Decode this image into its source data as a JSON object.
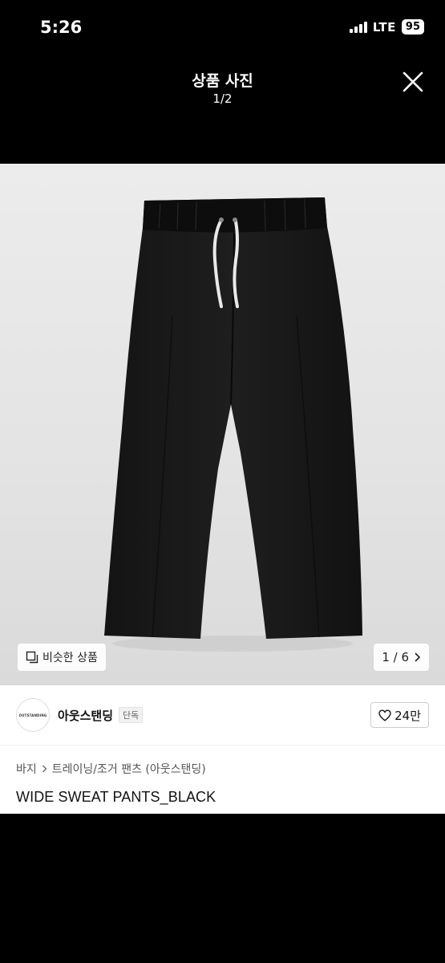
{
  "status_bar": {
    "time": "5:26",
    "network": "LTE",
    "battery": "95"
  },
  "viewer": {
    "title": "상품 사진",
    "counter": "1/2",
    "close_icon": "close-icon"
  },
  "photo": {
    "subject": "black sweat pants with white drawstring",
    "similar_button_label": "비슷한 상품",
    "similar_icon": "copy-icon",
    "page_indicator": "1 / 6",
    "next_icon": "chevron-right-icon"
  },
  "brand": {
    "logo_text": "OUTSTANDING",
    "name": "아웃스탠딩",
    "badge": "단독",
    "likes": "24만",
    "like_icon": "heart-icon"
  },
  "breadcrumb": {
    "items": [
      "바지",
      "트레이닝/조거 팬츠 (아웃스탠딩)"
    ]
  },
  "product": {
    "title": "WIDE SWEAT PANTS_BLACK"
  },
  "colors": {
    "background": "#000000",
    "photo_background": "#e8e8e8",
    "panel": "#ffffff"
  }
}
